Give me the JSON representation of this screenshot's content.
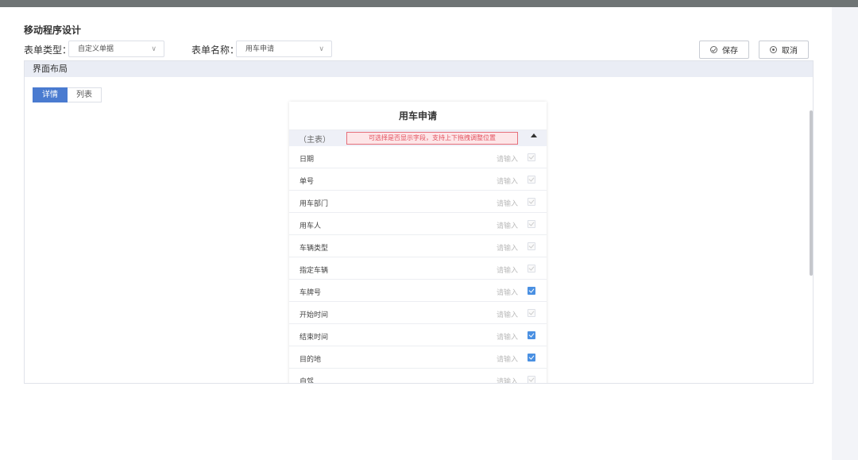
{
  "page": {
    "title": "移动程序设计"
  },
  "filters": {
    "form_type": {
      "label": "表单类型：",
      "value": "自定义单据"
    },
    "form_name": {
      "label": "表单名称：",
      "value": "用车申请"
    }
  },
  "toolbar": {
    "save_label": "保存",
    "cancel_label": "取消"
  },
  "panel": {
    "title": "界面布局",
    "tabs": [
      {
        "label": "详情",
        "active": true
      },
      {
        "label": "列表",
        "active": false
      }
    ]
  },
  "form": {
    "title": "用车申请",
    "main_label": "（主表）",
    "hint": "可选择是否显示字段，支持上下拖拽调整位置",
    "fields": [
      {
        "name": "日期",
        "placeholder": "请输入",
        "checked": false
      },
      {
        "name": "单号",
        "placeholder": "请输入",
        "checked": false
      },
      {
        "name": "用车部门",
        "placeholder": "请输入",
        "checked": false
      },
      {
        "name": "用车人",
        "placeholder": "请输入",
        "checked": false
      },
      {
        "name": "车辆类型",
        "placeholder": "请输入",
        "checked": false
      },
      {
        "name": "指定车辆",
        "placeholder": "请输入",
        "checked": false
      },
      {
        "name": "车牌号",
        "placeholder": "请输入",
        "checked": true
      },
      {
        "name": "开始时间",
        "placeholder": "请输入",
        "checked": false
      },
      {
        "name": "结束时间",
        "placeholder": "请输入",
        "checked": true
      },
      {
        "name": "目的地",
        "placeholder": "请输入",
        "checked": true
      },
      {
        "name": "自驾",
        "placeholder": "请输入",
        "checked": false
      }
    ]
  },
  "colors": {
    "accent": "#4a7bd0",
    "checkbox_on": "#4a90e2",
    "hint_border": "#e66f7a",
    "hint_text": "#e2525f"
  }
}
